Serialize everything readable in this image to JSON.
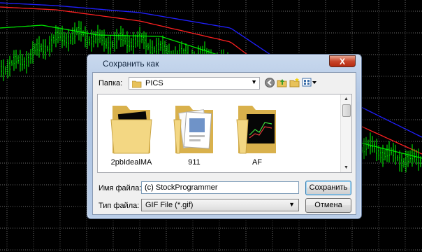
{
  "dialog": {
    "title": "Сохранить как",
    "close_label": "X",
    "folder_label": "Папка:",
    "current_folder": "PICS",
    "files": [
      {
        "name": "2pbIdealMA",
        "icon": "folder-chart-icon"
      },
      {
        "name": "911",
        "icon": "folder-documents-icon"
      },
      {
        "name": "AF",
        "icon": "folder-chart-icon"
      }
    ],
    "filename_label": "Имя файла:",
    "filename_value": "(c) StockProgrammer",
    "filetype_label": "Тип файла:",
    "filetype_value": "GIF File (*.gif)",
    "save_label": "Сохранить",
    "cancel_label": "Отмена"
  },
  "chart": {
    "background": "#000000",
    "grid_color": "#8f8f8f",
    "price_color": "#00ff00",
    "ma_slow_color": "#2020ff",
    "ma_mid_color": "#ff2020",
    "ma_fast_color": "#00e000"
  }
}
